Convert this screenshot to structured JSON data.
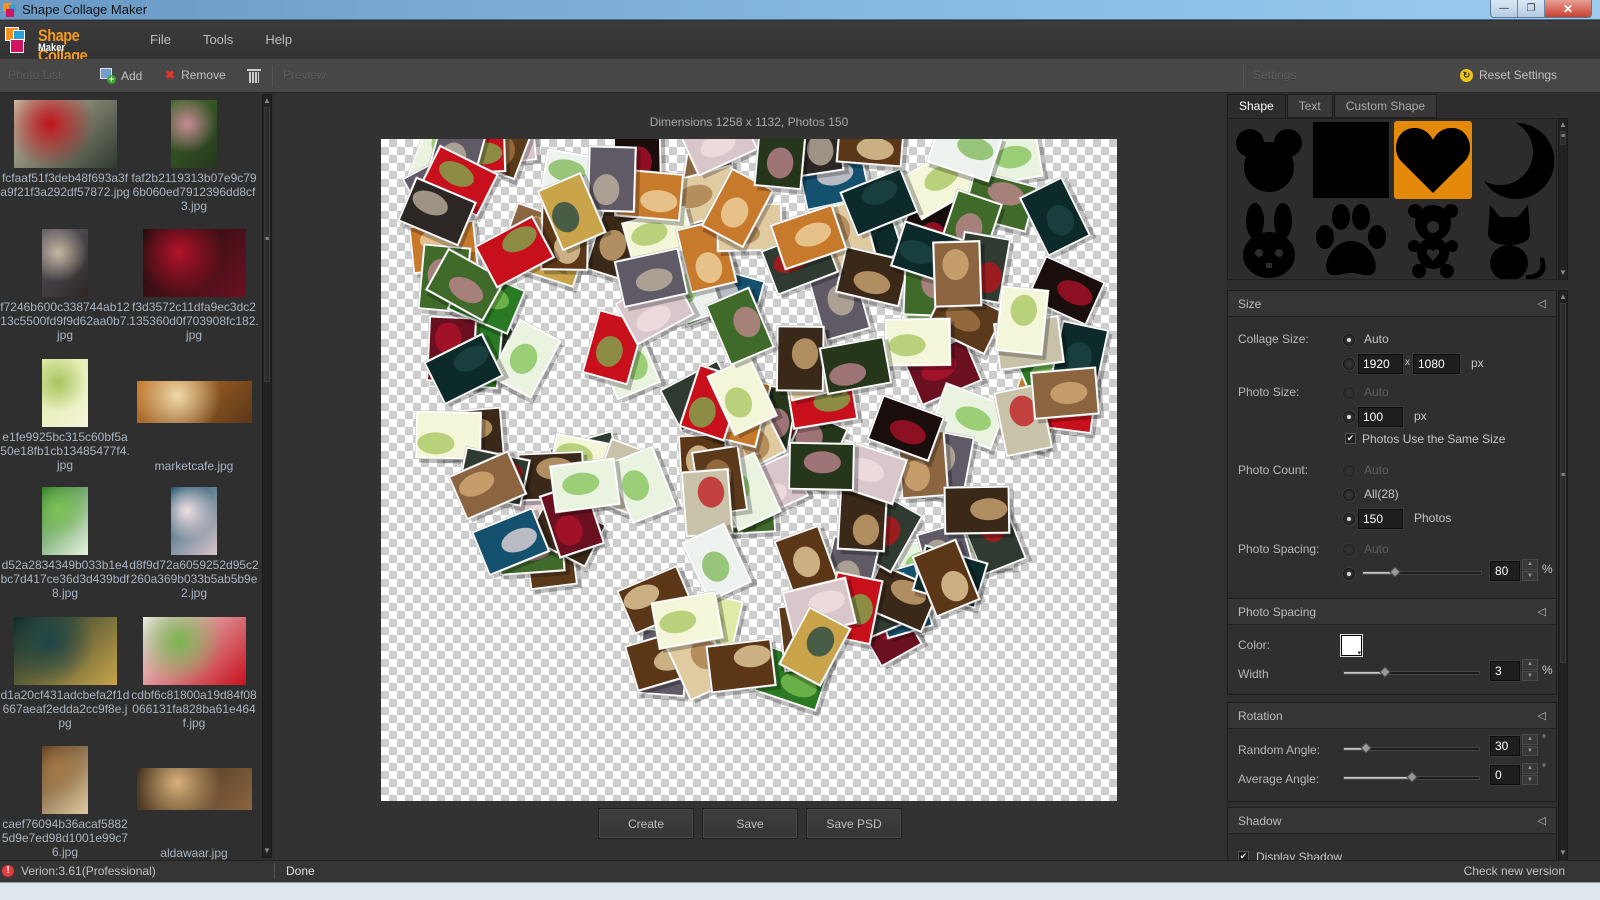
{
  "window": {
    "title": "Shape Collage Maker",
    "controls": {
      "minimize": "—",
      "restore": "❐",
      "close": "✕"
    }
  },
  "brand": {
    "line1": "Shape Collage",
    "line2": "Maker",
    "colors": {
      "orange": "#f7931e",
      "blue": "#2a9fd8",
      "pink": "#d3135f"
    }
  },
  "menu": [
    "File",
    "Tools",
    "Help"
  ],
  "toolbar": {
    "photo_list_label": "Photo List",
    "add_label": "Add",
    "remove_label": "Remove",
    "preview_label": "Preview",
    "settings_label": "Settings",
    "reset_label": "Reset Settings"
  },
  "photos": [
    {
      "name": "fcfaaf51f3deb48f693a3fa9f21f3a292df57872.jpg",
      "orientation": "landscape",
      "colors": [
        "#c8c2a8",
        "#c0141a",
        "#2f3a30"
      ]
    },
    {
      "name": "faf2b2119313b07e9c796b060ed7912396dd8cf3.jpg",
      "orientation": "portrait",
      "colors": [
        "#3f6a2a",
        "#c88a96",
        "#25361b"
      ]
    },
    {
      "name": "f7246b600c338744ab1213c5500fd9f9d62aa0b7.jpg",
      "orientation": "portrait",
      "colors": [
        "#5f5a66",
        "#c4b8a4",
        "#2c2624"
      ]
    },
    {
      "name": "f3d3572c11dfa9ec3dc2135360d0f703908fc182.jpg",
      "orientation": "landscape",
      "colors": [
        "#1a0e0c",
        "#b3122a",
        "#6b1020"
      ]
    },
    {
      "name": "e1fe9925bc315c60bf5a50e18fb1cb13485477f4.jpg",
      "orientation": "portrait",
      "colors": [
        "#dfeaa6",
        "#a7c45e",
        "#f3f6d8"
      ]
    },
    {
      "name": "marketcafe.jpg",
      "orientation": "wide",
      "colors": [
        "#c77a2c",
        "#f0d9a8",
        "#5b3718"
      ]
    },
    {
      "name": "d52a2834349b033b1e4bc7d417ce36d3d439bdf8.jpg",
      "orientation": "portrait",
      "colors": [
        "#2a7a24",
        "#7fc356",
        "#e9f3e0"
      ]
    },
    {
      "name": "d8f9d72a6059252d95c2260a369b033b5ab5b9e2.jpg",
      "orientation": "portrait",
      "colors": [
        "#14516e",
        "#f1e0e2",
        "#d9c6cb"
      ]
    },
    {
      "name": "d1a20cf431adcbefa2f1d667aeaf2edda2cc9f8e.jpg",
      "orientation": "landscape",
      "colors": [
        "#0d2a2a",
        "#1d4545",
        "#c9a44a"
      ]
    },
    {
      "name": "cdbf6c81800a19d84f08066131fa828ba61e464f.jpg",
      "orientation": "landscape",
      "colors": [
        "#eef2ef",
        "#7ab552",
        "#c8101d"
      ]
    },
    {
      "name": "caef76094b36acaf58825d9e7ed98d1001e99c76.jpg",
      "orientation": "portrait",
      "colors": [
        "#5b3a1c",
        "#a57a45",
        "#e0caa0"
      ]
    },
    {
      "name": "aldawaar.jpg",
      "orientation": "wide",
      "colors": [
        "#3a2818",
        "#d8b07a",
        "#8a6540"
      ]
    }
  ],
  "canvas": {
    "dimensions_text": "Dimensions 1258 x 1132, Photos 150",
    "shape": "heart",
    "photo_count": 150
  },
  "actions": {
    "create": "Create",
    "save": "Save",
    "save_psd": "Save PSD"
  },
  "right_panel": {
    "tabs": [
      {
        "label": "Shape",
        "active": true
      },
      {
        "label": "Text",
        "active": false
      },
      {
        "label": "Custom Shape",
        "active": false
      }
    ],
    "shapes": [
      {
        "name": "mouse",
        "selected": false
      },
      {
        "name": "square",
        "selected": false
      },
      {
        "name": "heart",
        "selected": true
      },
      {
        "name": "moon",
        "selected": false
      },
      {
        "name": "rabbit",
        "selected": false
      },
      {
        "name": "paw",
        "selected": false
      },
      {
        "name": "bear",
        "selected": false
      },
      {
        "name": "cat",
        "selected": false
      }
    ],
    "accent": "#e5890a",
    "size": {
      "title": "Size",
      "collage_size_label": "Collage Size:",
      "collage_auto_label": "Auto",
      "collage_auto_selected": true,
      "width": "1920",
      "x_label": "x",
      "height": "1080",
      "px": "px",
      "photo_size_label": "Photo Size:",
      "photo_auto_label": "Auto",
      "photo_size_value": "100",
      "photo_px": "px",
      "same_size_label": "Photos Use the Same Size",
      "same_size_checked": true,
      "photo_count_label": "Photo Count:",
      "count_auto_label": "Auto",
      "count_all_label": "All(28)",
      "count_value": "150",
      "count_unit": "Photos",
      "spacing_label": "Photo Spacing:",
      "spacing_auto_label": "Auto",
      "spacing_value": "80",
      "spacing_fraction": 0.27,
      "spacing_unit": "%"
    },
    "border": {
      "title": "Photo Spacing",
      "color_label": "Color:",
      "color": "#ffffff",
      "width_label": "Width",
      "width_value": "3",
      "width_fraction": 0.3,
      "width_unit": "%"
    },
    "rotation": {
      "title": "Rotation",
      "random_label": "Random Angle:",
      "random_value": "30",
      "random_fraction": 0.16,
      "average_label": "Average Angle:",
      "average_value": "0",
      "average_fraction": 0.5,
      "unit": "°"
    },
    "shadow": {
      "title": "Shadow",
      "display_label": "Display Shadow",
      "display_checked": true
    }
  },
  "status": {
    "version": "Verion:3.61(Professional)",
    "state": "Done",
    "check_update": "Check new version"
  }
}
